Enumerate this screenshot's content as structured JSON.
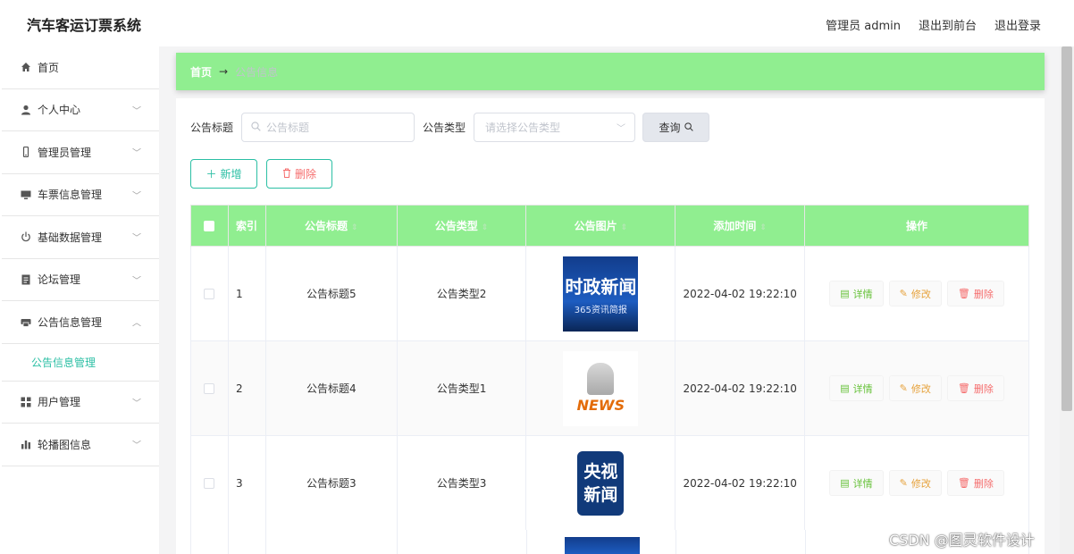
{
  "header": {
    "app_title": "汽车客运订票系统",
    "admin_label": "管理员 admin",
    "to_frontend": "退出到前台",
    "logout": "退出登录"
  },
  "sidebar": {
    "items": [
      {
        "label": "首页",
        "icon": "home-icon"
      },
      {
        "label": "个人中心",
        "icon": "user-icon"
      },
      {
        "label": "管理员管理",
        "icon": "mobile-icon"
      },
      {
        "label": "车票信息管理",
        "icon": "monitor-icon"
      },
      {
        "label": "基础数据管理",
        "icon": "power-icon"
      },
      {
        "label": "论坛管理",
        "icon": "document-icon"
      },
      {
        "label": "公告信息管理",
        "icon": "printer-icon",
        "expanded": true
      },
      {
        "label": "用户管理",
        "icon": "grid-icon"
      },
      {
        "label": "轮播图信息",
        "icon": "bar-chart-icon"
      }
    ],
    "submenu_active": "公告信息管理"
  },
  "breadcrumb": {
    "home": "首页",
    "sep": "→",
    "current": "公告信息"
  },
  "search": {
    "title_label": "公告标题",
    "title_placeholder": "公告标题",
    "type_label": "公告类型",
    "type_placeholder": "请选择公告类型",
    "query_button": "查询"
  },
  "actions": {
    "add": "新增",
    "delete": "删除"
  },
  "table": {
    "headers": {
      "index": "索引",
      "title": "公告标题",
      "type": "公告类型",
      "image": "公告图片",
      "time": "添加时间",
      "ops": "操作"
    },
    "rows": [
      {
        "index": "1",
        "title": "公告标题5",
        "type": "公告类型2",
        "image_text": "时政新闻",
        "image_sub": "365资讯简报",
        "time": "2022-04-02 19:22:10"
      },
      {
        "index": "2",
        "title": "公告标题4",
        "type": "公告类型1",
        "image_text": "NEWS",
        "image_sub": "",
        "time": "2022-04-02 19:22:10"
      },
      {
        "index": "3",
        "title": "公告标题3",
        "type": "公告类型3",
        "image_text": "央视新闻",
        "image_sub": "",
        "time": "2022-04-02 19:22:10"
      }
    ],
    "op_labels": {
      "detail": "详情",
      "edit": "修改",
      "remove": "删除"
    }
  },
  "watermark": "CSDN @图灵软件设计",
  "colors": {
    "accent": "#90ee90",
    "teal": "#2bbfa4",
    "danger": "#f56c6c",
    "warning": "#e6a23c",
    "success": "#67c23a"
  }
}
